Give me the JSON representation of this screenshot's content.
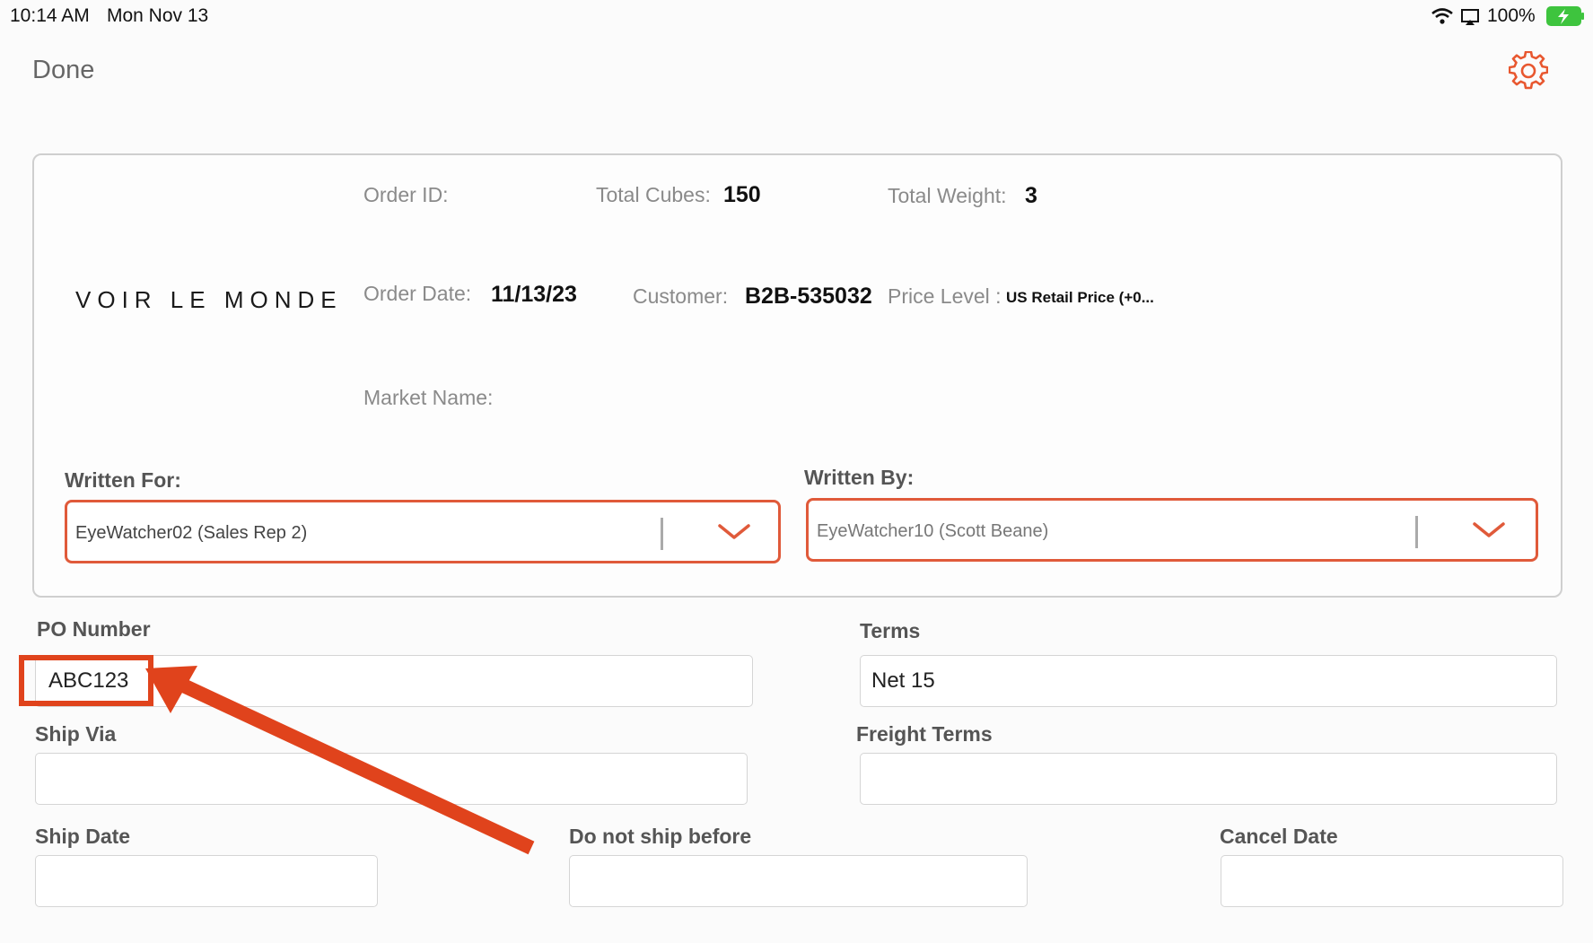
{
  "status_bar": {
    "time": "10:14 AM",
    "date": "Mon Nov 13",
    "battery": "100%",
    "icons": [
      "wifi-icon",
      "screen-mirror-icon",
      "battery-charging-icon"
    ]
  },
  "header": {
    "done_label": "Done",
    "settings_icon": "gear-icon",
    "accent": "#e8572f"
  },
  "order": {
    "brand": "VOIR LE MONDE",
    "order_id_label": "Order ID:",
    "order_id_value": "",
    "total_cubes_label": "Total Cubes:",
    "total_cubes_value": "150",
    "total_weight_label": "Total Weight:",
    "total_weight_value": "3",
    "order_date_label": "Order Date:",
    "order_date_value": "11/13/23",
    "customer_label": "Customer:",
    "customer_value": "B2B-535032",
    "price_level_label": "Price Level :",
    "price_level_value": "US Retail Price (+0...",
    "market_name_label": "Market Name:",
    "market_name_value": ""
  },
  "written_for": {
    "label": "Written For:",
    "value": "EyeWatcher02 (Sales Rep 2)"
  },
  "written_by": {
    "label": "Written By:",
    "value": "EyeWatcher10 (Scott Beane)"
  },
  "form": {
    "po_number": {
      "label": "PO Number",
      "value": "ABC123"
    },
    "terms": {
      "label": "Terms",
      "value": "Net 15"
    },
    "ship_via": {
      "label": "Ship Via",
      "value": ""
    },
    "freight_terms": {
      "label": "Freight Terms",
      "value": ""
    },
    "ship_date": {
      "label": "Ship Date",
      "value": ""
    },
    "do_not_ship_before": {
      "label": "Do not ship before",
      "value": ""
    },
    "cancel_date": {
      "label": "Cancel Date",
      "value": ""
    }
  },
  "annotation": {
    "color": "#e0431c"
  }
}
